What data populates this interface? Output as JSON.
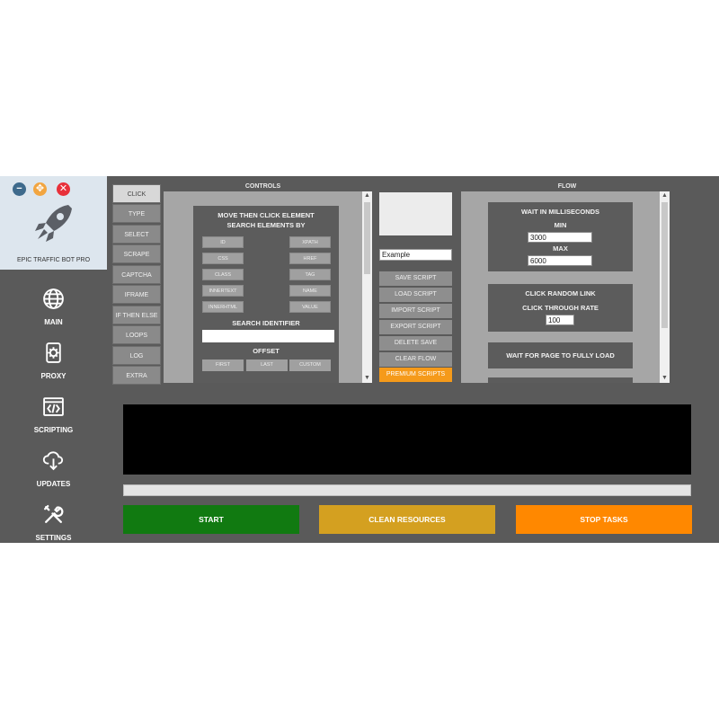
{
  "brand": {
    "name": "EPIC TRAFFIC BOT PRO"
  },
  "window_controls": [
    {
      "name": "minimize",
      "glyph": "−",
      "color": "#3e6a8c"
    },
    {
      "name": "move",
      "glyph": "✥",
      "color": "#f2a540"
    },
    {
      "name": "close",
      "glyph": "✕",
      "color": "#e8303a"
    }
  ],
  "sidenav": [
    {
      "label": "MAIN",
      "icon": "globe-icon"
    },
    {
      "label": "PROXY",
      "icon": "proxy-gear-icon"
    },
    {
      "label": "SCRIPTING",
      "icon": "code-icon"
    },
    {
      "label": "UPDATES",
      "icon": "cloud-download-icon"
    },
    {
      "label": "SETTINGS",
      "icon": "tools-icon"
    }
  ],
  "controls": {
    "title": "CONTROLS",
    "tabs": [
      "CLICK",
      "TYPE",
      "SELECT",
      "SCRAPE",
      "CAPTCHA",
      "IFRAME",
      "IF THEN ELSE",
      "LOOPS",
      "LOG",
      "EXTRA"
    ],
    "active_tab": "CLICK",
    "panel": {
      "heading_line1": "MOVE THEN CLICK ELEMENT",
      "heading_line2": "SEARCH ELEMENTS BY",
      "search_by_left": [
        "ID",
        "CSS",
        "CLASS",
        "INNERTEXT",
        "INNERHTML"
      ],
      "search_by_right": [
        "XPATH",
        "HREF",
        "TAG",
        "NAME",
        "VALUE"
      ],
      "search_identifier_label": "SEARCH IDENTIFIER",
      "search_identifier_value": "",
      "offset_label": "OFFSET",
      "offset_buttons": [
        "FIRST",
        "LAST",
        "CUSTOM"
      ]
    }
  },
  "script": {
    "name_value": "Example",
    "buttons": [
      "SAVE SCRIPT",
      "LOAD SCRIPT",
      "IMPORT SCRIPT",
      "EXPORT SCRIPT",
      "DELETE SAVE",
      "CLEAR FLOW"
    ],
    "premium_button": "PREMIUM SCRIPTS",
    "premium_color": "#f59a1a"
  },
  "flow": {
    "title": "FLOW",
    "wait": {
      "title": "WAIT IN MILLISECONDS",
      "min_label": "MIN",
      "min_value": "3000",
      "max_label": "MAX",
      "max_value": "6000"
    },
    "random_link": {
      "title": "CLICK RANDOM LINK",
      "ctr_label": "CLICK THROUGH RATE",
      "ctr_value": "100"
    },
    "page_load": {
      "title": "WAIT FOR PAGE TO FULLY LOAD"
    }
  },
  "progress": {
    "value": 0
  },
  "actions": {
    "start": {
      "label": "START",
      "color": "#117a11"
    },
    "clean": {
      "label": "CLEAN RESOURCES",
      "color": "#d4a020"
    },
    "stop": {
      "label": "STOP TASKS",
      "color": "#ff8800"
    }
  }
}
